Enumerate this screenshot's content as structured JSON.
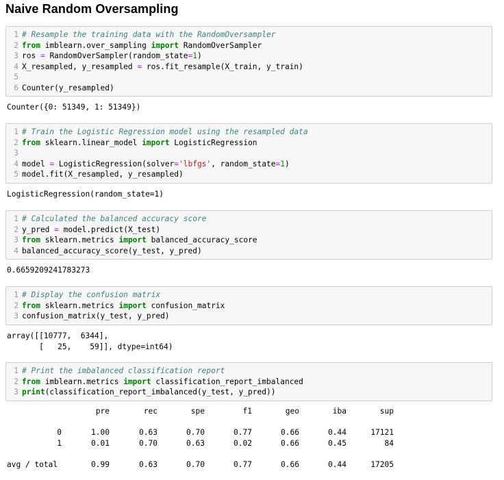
{
  "title": "Naive Random Oversampling",
  "cells": [
    {
      "lines": [
        {
          "n": "1",
          "tokens": [
            {
              "t": "cmt",
              "v": "# Resample the training data with the RandomOversampler"
            }
          ]
        },
        {
          "n": "2",
          "tokens": [
            {
              "t": "kw",
              "v": "from"
            },
            {
              "t": "",
              "v": " imblearn.over_sampling "
            },
            {
              "t": "kw",
              "v": "import"
            },
            {
              "t": "",
              "v": " RandomOverSampler"
            }
          ]
        },
        {
          "n": "3",
          "tokens": [
            {
              "t": "",
              "v": "ros "
            },
            {
              "t": "op",
              "v": "="
            },
            {
              "t": "",
              "v": " RandomOverSampler(random_state"
            },
            {
              "t": "op",
              "v": "="
            },
            {
              "t": "num",
              "v": "1"
            },
            {
              "t": "",
              "v": ")"
            }
          ]
        },
        {
          "n": "4",
          "tokens": [
            {
              "t": "",
              "v": "X_resampled, y_resampled "
            },
            {
              "t": "op",
              "v": "="
            },
            {
              "t": "",
              "v": " ros.fit_resample(X_train, y_train)"
            }
          ]
        },
        {
          "n": "5",
          "tokens": []
        },
        {
          "n": "6",
          "tokens": [
            {
              "t": "",
              "v": "Counter(y_resampled)"
            }
          ]
        }
      ],
      "output": "Counter({0: 51349, 1: 51349})"
    },
    {
      "lines": [
        {
          "n": "1",
          "tokens": [
            {
              "t": "cmt",
              "v": "# Train the Logistic Regression model using the resampled data"
            }
          ]
        },
        {
          "n": "2",
          "tokens": [
            {
              "t": "kw",
              "v": "from"
            },
            {
              "t": "",
              "v": " sklearn.linear_model "
            },
            {
              "t": "kw",
              "v": "import"
            },
            {
              "t": "",
              "v": " LogisticRegression"
            }
          ]
        },
        {
          "n": "3",
          "tokens": []
        },
        {
          "n": "4",
          "tokens": [
            {
              "t": "",
              "v": "model "
            },
            {
              "t": "op",
              "v": "="
            },
            {
              "t": "",
              "v": " LogisticRegression(solver"
            },
            {
              "t": "op",
              "v": "="
            },
            {
              "t": "str",
              "v": "'lbfgs'"
            },
            {
              "t": "",
              "v": ", random_state"
            },
            {
              "t": "op",
              "v": "="
            },
            {
              "t": "num",
              "v": "1"
            },
            {
              "t": "",
              "v": ")"
            }
          ]
        },
        {
          "n": "5",
          "tokens": [
            {
              "t": "",
              "v": "model.fit(X_resampled, y_resampled)"
            }
          ]
        }
      ],
      "output": "LogisticRegression(random_state=1)"
    },
    {
      "lines": [
        {
          "n": "1",
          "tokens": [
            {
              "t": "cmt",
              "v": "# Calculated the balanced accuracy score"
            }
          ]
        },
        {
          "n": "2",
          "tokens": [
            {
              "t": "",
              "v": "y_pred "
            },
            {
              "t": "op",
              "v": "="
            },
            {
              "t": "",
              "v": " model.predict(X_test)"
            }
          ]
        },
        {
          "n": "3",
          "tokens": [
            {
              "t": "kw",
              "v": "from"
            },
            {
              "t": "",
              "v": " sklearn.metrics "
            },
            {
              "t": "kw",
              "v": "import"
            },
            {
              "t": "",
              "v": " balanced_accuracy_score"
            }
          ]
        },
        {
          "n": "4",
          "tokens": [
            {
              "t": "",
              "v": "balanced_accuracy_score(y_test, y_pred)"
            }
          ]
        }
      ],
      "output": "0.6659209241783273"
    },
    {
      "lines": [
        {
          "n": "1",
          "tokens": [
            {
              "t": "cmt",
              "v": "# Display the confusion matrix"
            }
          ]
        },
        {
          "n": "2",
          "tokens": [
            {
              "t": "kw",
              "v": "from"
            },
            {
              "t": "",
              "v": " sklearn.metrics "
            },
            {
              "t": "kw",
              "v": "import"
            },
            {
              "t": "",
              "v": " confusion_matrix"
            }
          ]
        },
        {
          "n": "3",
          "tokens": [
            {
              "t": "",
              "v": "confusion_matrix(y_test, y_pred)"
            }
          ]
        }
      ],
      "output": "array([[10777,  6344],\n       [   25,    59]], dtype=int64)"
    },
    {
      "lines": [
        {
          "n": "1",
          "tokens": [
            {
              "t": "cmt",
              "v": "# Print the imbalanced classification report"
            }
          ]
        },
        {
          "n": "2",
          "tokens": [
            {
              "t": "kw",
              "v": "from"
            },
            {
              "t": "",
              "v": " imblearn.metrics "
            },
            {
              "t": "kw",
              "v": "import"
            },
            {
              "t": "",
              "v": " classification_report_imbalanced"
            }
          ]
        },
        {
          "n": "3",
          "tokens": [
            {
              "t": "kw",
              "v": "print"
            },
            {
              "t": "",
              "v": "(classification_report_imbalanced(y_test, y_pred))"
            }
          ]
        }
      ],
      "output": ""
    }
  ],
  "report": {
    "headers": [
      "pre",
      "rec",
      "spe",
      "f1",
      "geo",
      "iba",
      "sup"
    ],
    "rows": [
      {
        "label": "0",
        "values": [
          "1.00",
          "0.63",
          "0.70",
          "0.77",
          "0.66",
          "0.44",
          "17121"
        ]
      },
      {
        "label": "1",
        "values": [
          "0.01",
          "0.70",
          "0.63",
          "0.02",
          "0.66",
          "0.45",
          "84"
        ]
      }
    ],
    "total": {
      "label": "avg / total",
      "values": [
        "0.99",
        "0.63",
        "0.70",
        "0.77",
        "0.66",
        "0.44",
        "17205"
      ]
    }
  }
}
